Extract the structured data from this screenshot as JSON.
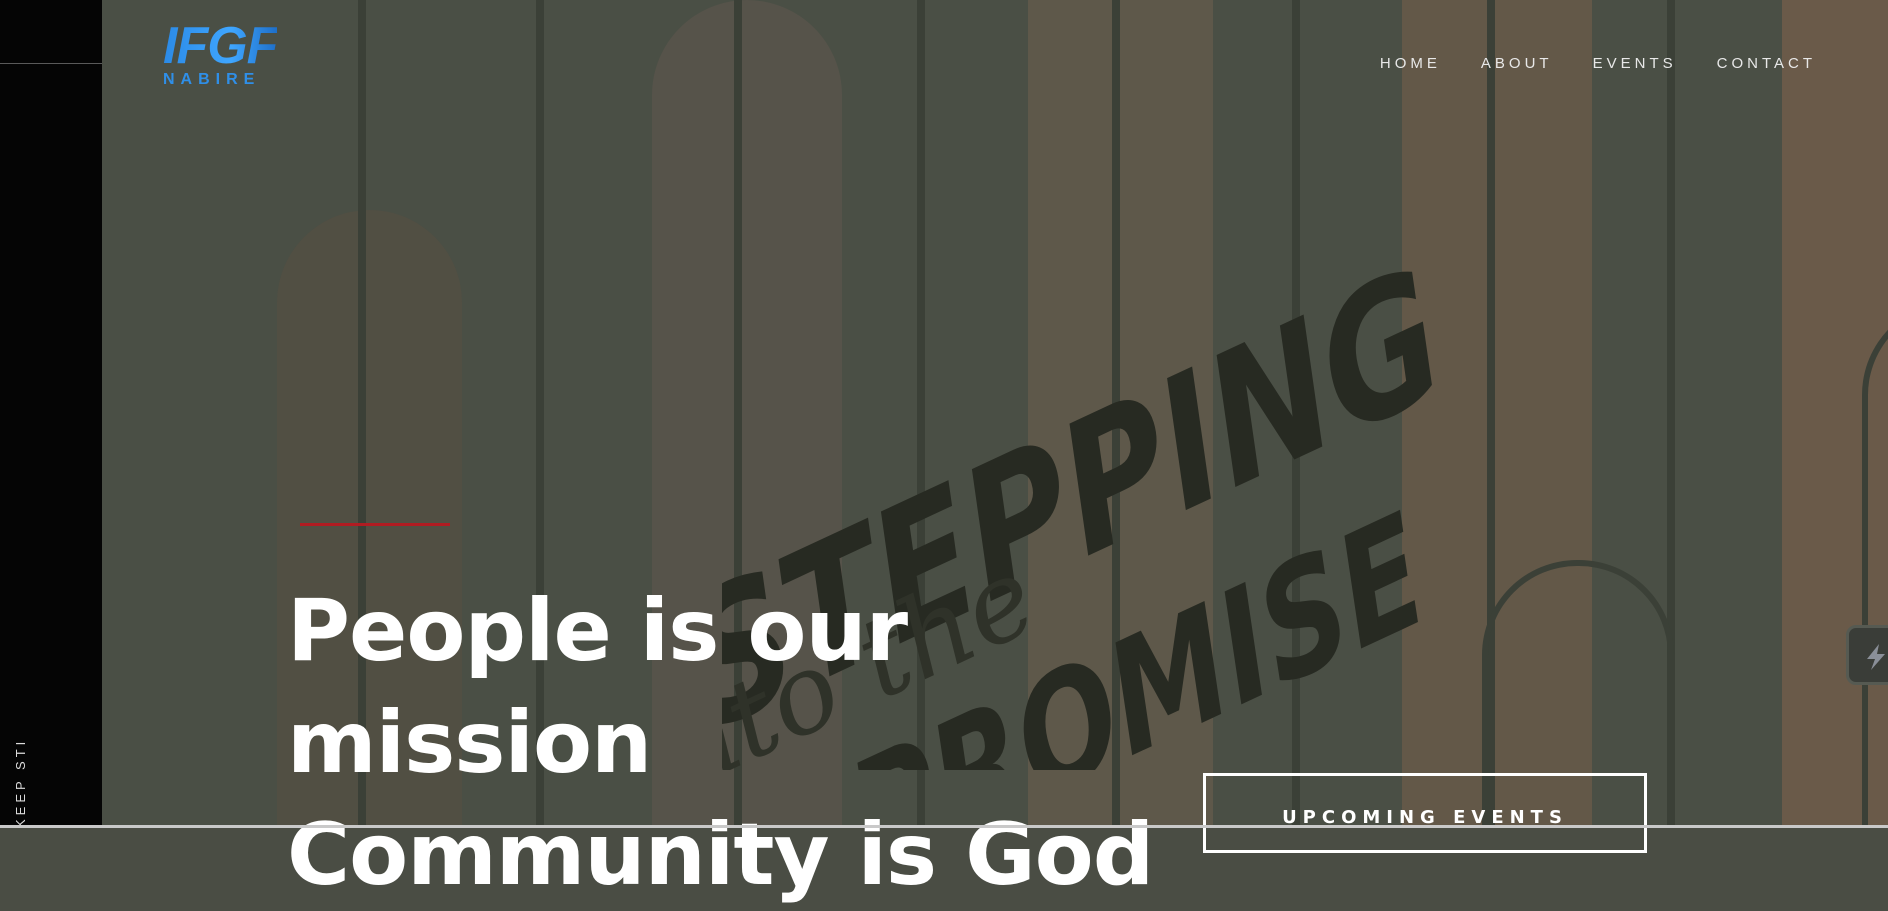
{
  "brand": {
    "logo_main": "IFGF",
    "logo_sub": "NABIRE",
    "accent_color": "#2f8fe8"
  },
  "nav": {
    "items": [
      "HOME",
      "ABOUT",
      "EVENTS",
      "CONTACT"
    ]
  },
  "side_rail": {
    "text": "KEEP STI"
  },
  "hero": {
    "background_art": {
      "word_1": "STEPPING",
      "word_2": "into the",
      "word_3": "PROMISE"
    },
    "headline_lines": [
      "People is our",
      "mission",
      "Community is God"
    ],
    "accent_line_color": "#b01c22",
    "cta_label": "UPCOMING EVENTS"
  },
  "widget": {
    "icon": "lightning-icon"
  }
}
